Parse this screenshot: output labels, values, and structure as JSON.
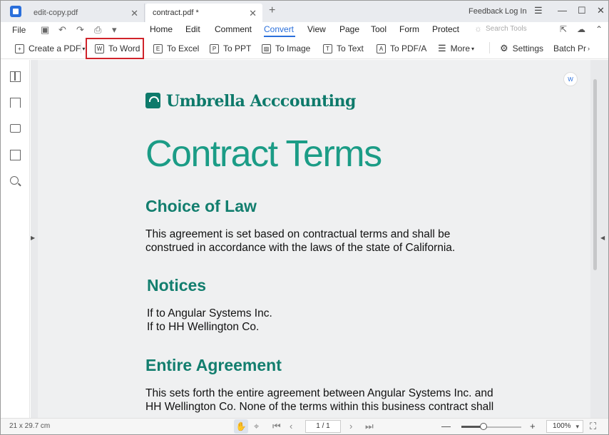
{
  "tabs": [
    {
      "label": "edit-copy.pdf"
    },
    {
      "label": "contract.pdf *"
    }
  ],
  "titlebar": {
    "feedback": "Feedback",
    "login": "Log In"
  },
  "menu": {
    "file": "File",
    "items": [
      "Home",
      "Edit",
      "Comment",
      "Convert",
      "View",
      "Page",
      "Tool",
      "Form",
      "Protect"
    ],
    "active": "Convert",
    "search_placeholder": "Search Tools"
  },
  "toolbar": {
    "create_pdf": "Create a PDF",
    "to_word": "To Word",
    "to_excel": "To Excel",
    "to_ppt": "To PPT",
    "to_image": "To Image",
    "to_text": "To Text",
    "to_pdfa": "To PDF/A",
    "more": "More",
    "settings": "Settings",
    "batch": "Batch Pr"
  },
  "document": {
    "brand": "Umbrella Acccounting",
    "title": "Contract Terms",
    "sections": [
      {
        "heading": "Choice of Law",
        "lines": [
          "This agreement is set based on contractual terms and shall be",
          "construed in accordance with the laws of the state of California."
        ]
      },
      {
        "heading": "Notices",
        "lines": [
          "If to Angular Systems Inc.",
          "If to HH Wellington Co."
        ]
      },
      {
        "heading": "Entire Agreement",
        "lines": [
          "This sets forth the entire agreement between Angular Systems Inc. and",
          "HH Wellington Co. None of the terms within this business contract shall"
        ]
      }
    ]
  },
  "status": {
    "dimensions": "21 x 29.7 cm",
    "page": "1 / 1",
    "zoom": "100%",
    "zoom_level": 0.38
  },
  "colors": {
    "accent": "#2a6fdb",
    "brand": "#0e7a6b",
    "highlight": "#d0232a"
  }
}
